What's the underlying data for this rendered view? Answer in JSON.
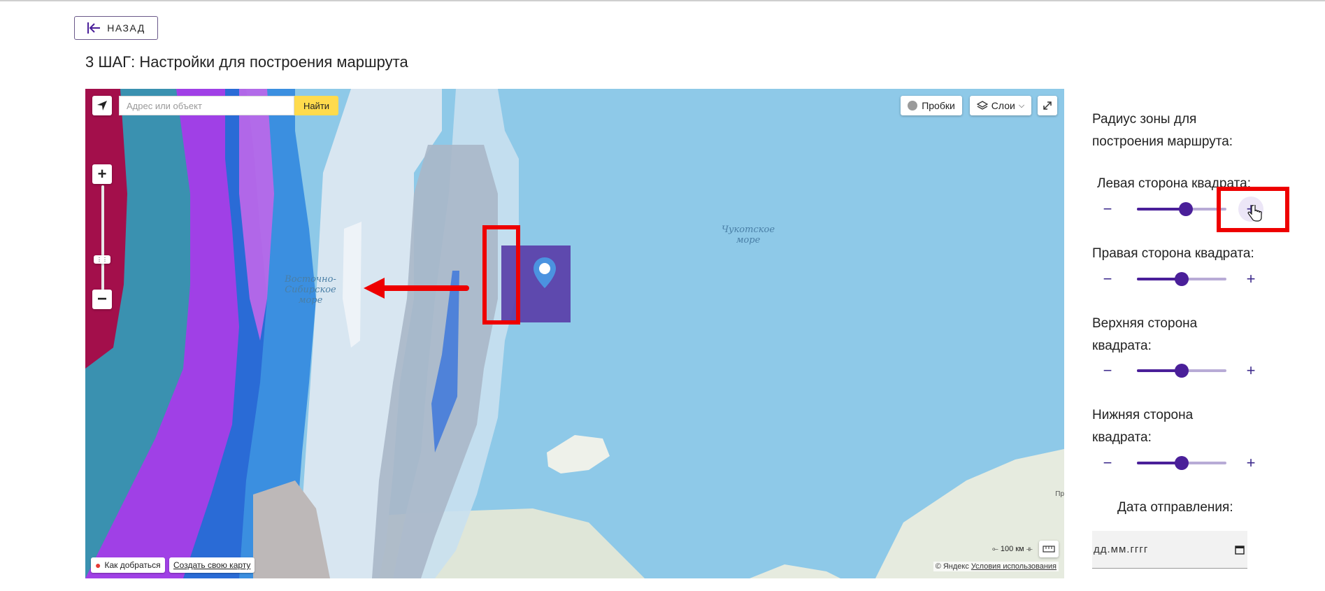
{
  "header": {
    "back_label": "НАЗАД"
  },
  "page": {
    "title": "3 ШАГ: Настройки для построения маршрута"
  },
  "map": {
    "search_placeholder": "Адрес или объект",
    "find_label": "Найти",
    "traffic_label": "Пробки",
    "layers_label": "Слои",
    "sea_label_chukchi": [
      "Чукотское",
      "море"
    ],
    "sea_label_east_siberian": [
      "Восточно-",
      "Сибирское",
      "море"
    ],
    "route_label": "Как добраться",
    "create_map_label": "Создать свою карту",
    "scale_label": "100 км",
    "copyright_text": "© Яндекс",
    "terms_label": "Условия использования",
    "edge_label": "Пр"
  },
  "panel": {
    "radius_title_line1": "Радиус зоны для",
    "radius_title_line2": "построения маршрута:",
    "date_label": "Дата отправления:",
    "date_placeholder": "дд.мм.гггг",
    "sliders": [
      {
        "label_line1": "Левая сторона квадрата:",
        "label_line2": "",
        "value_fraction": 0.55
      },
      {
        "label_line1": "Правая сторона квадрата:",
        "label_line2": "",
        "value_fraction": 0.5
      },
      {
        "label_line1": "Верхняя сторона",
        "label_line2": "квадрата:",
        "value_fraction": 0.5
      },
      {
        "label_line1": "Нижняя сторона",
        "label_line2": "квадрата:",
        "value_fraction": 0.5
      }
    ]
  },
  "colors": {
    "accent": "#4a1f99",
    "highlight": "#ee0000",
    "zone": "#5a3ea8"
  }
}
